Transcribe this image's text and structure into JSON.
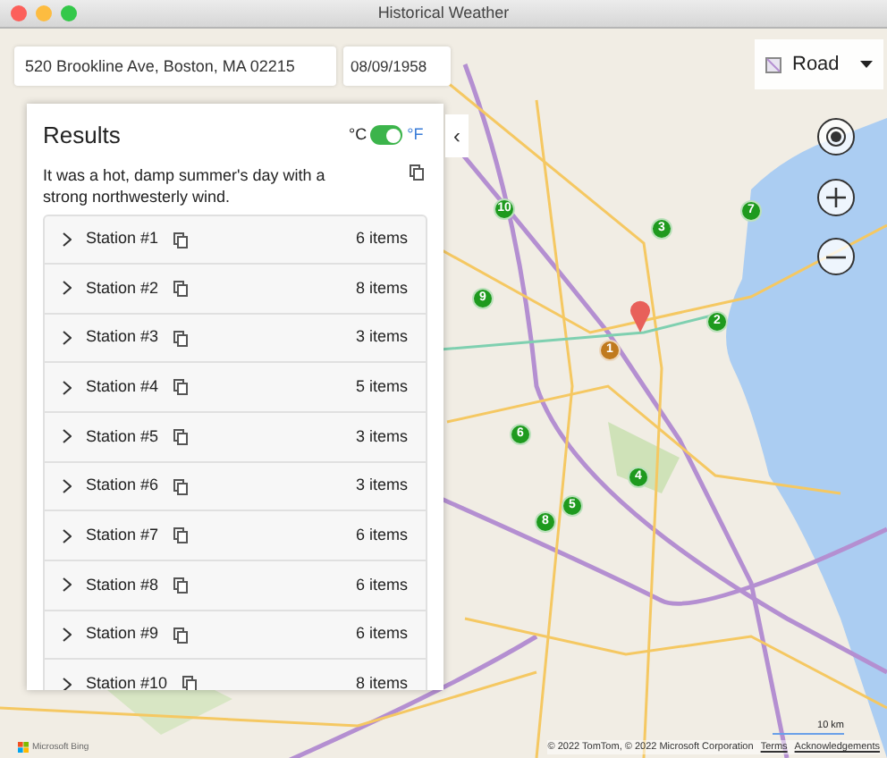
{
  "window": {
    "title": "Historical Weather"
  },
  "address": {
    "value": "520 Brookline Ave, Boston, MA 02215"
  },
  "date": {
    "value": "08/09/1958"
  },
  "results": {
    "title": "Results",
    "unit_celsius": "°C",
    "unit_fahrenheit": "°F",
    "unit_toggle": {
      "on": true
    },
    "summary": "It was a hot, damp summer's day with a strong northwesterly wind.",
    "stations": [
      {
        "name": "Station #1",
        "count": "6 items",
        "expanded": false
      },
      {
        "name": "Station #2",
        "count": "8 items",
        "expanded": false
      },
      {
        "name": "Station #3",
        "count": "3 items",
        "expanded": false
      },
      {
        "name": "Station #4",
        "count": "5 items",
        "expanded": false
      },
      {
        "name": "Station #5",
        "count": "3 items",
        "expanded": false
      },
      {
        "name": "Station #6",
        "count": "3 items",
        "expanded": false
      },
      {
        "name": "Station #7",
        "count": "6 items",
        "expanded": false
      },
      {
        "name": "Station #8",
        "count": "6 items",
        "expanded": false
      },
      {
        "name": "Station #9",
        "count": "6 items",
        "expanded": false
      },
      {
        "name": "Station #10",
        "count": "8 items",
        "expanded": false
      }
    ]
  },
  "collapse_button": {
    "label": "‹"
  },
  "map_style": {
    "value": "Road"
  },
  "markers": [
    {
      "label": "1",
      "color": "#c07a1e"
    },
    {
      "label": "2",
      "color": "#1e9a1e"
    },
    {
      "label": "3",
      "color": "#1e9a1e"
    },
    {
      "label": "4",
      "color": "#1e9a1e"
    },
    {
      "label": "5",
      "color": "#1e9a1e"
    },
    {
      "label": "6",
      "color": "#1e9a1e"
    },
    {
      "label": "7",
      "color": "#1e9a1e"
    },
    {
      "label": "8",
      "color": "#1e9a1e"
    },
    {
      "label": "9",
      "color": "#1e9a1e"
    },
    {
      "label": "10",
      "color": "#1e9a1e"
    }
  ],
  "scale": {
    "label": "10 km"
  },
  "attribution": {
    "text": "© 2022 TomTom, © 2022 Microsoft Corporation",
    "links": [
      "Terms",
      "Acknowledgements"
    ]
  },
  "logo": {
    "text": "Microsoft Bing"
  }
}
